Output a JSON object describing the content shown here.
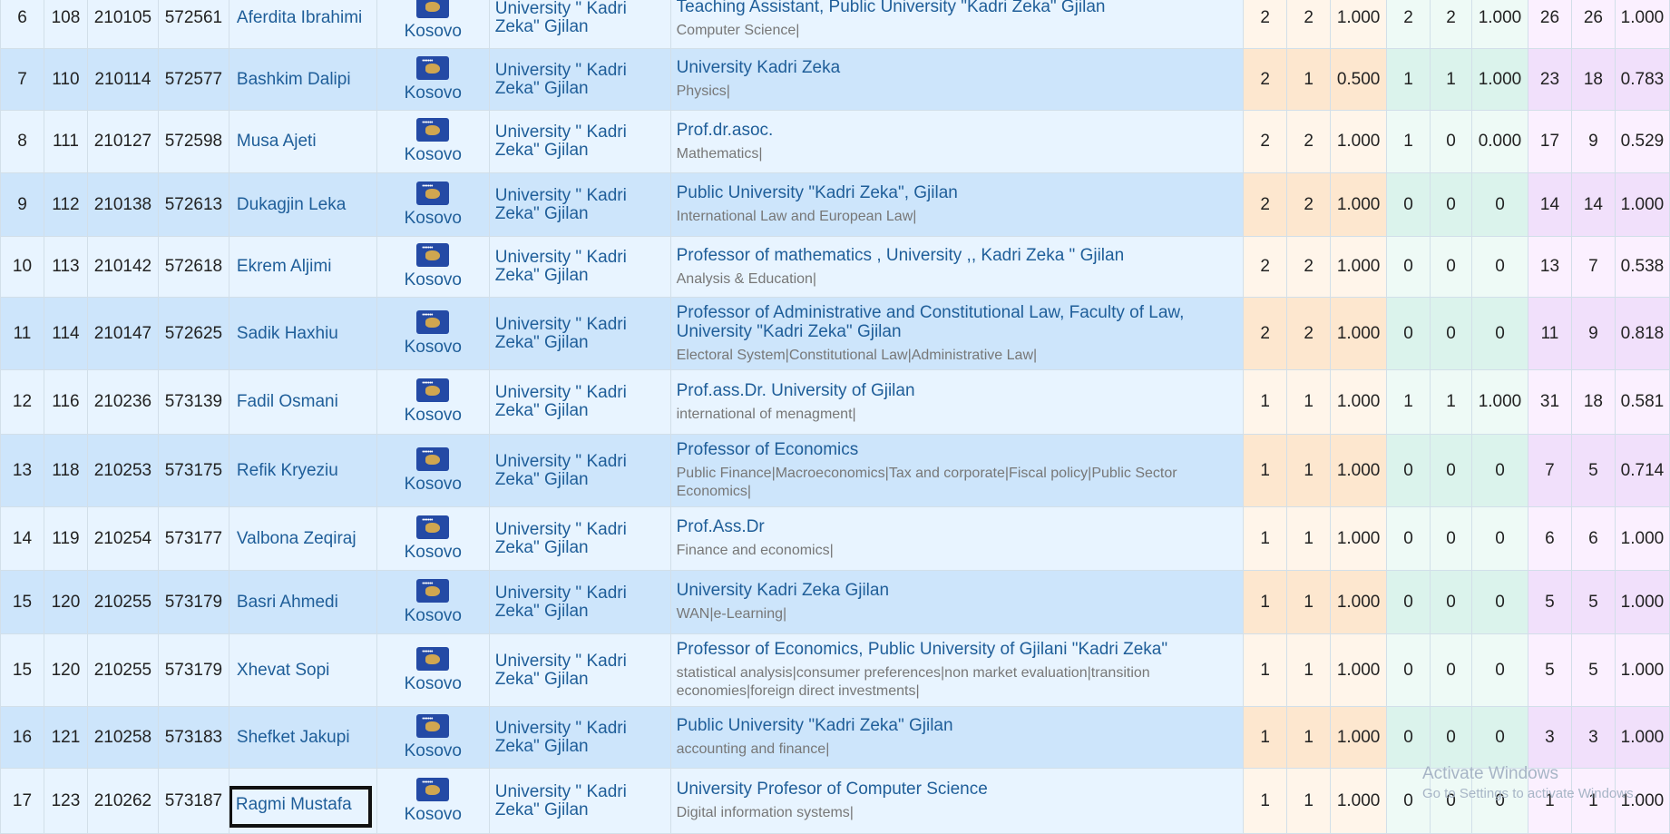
{
  "rows": [
    {
      "rank": "6",
      "id1": "108",
      "id2": "210105",
      "id3": "572561",
      "name": "Aferdita Ibrahimi",
      "country": "Kosovo",
      "institution": "University \" Kadri Zeka\" Gjilan",
      "position_title": "Teaching Assistant, Public University \"Kadri Zeka\" Gjilan",
      "position_area": "Computer Science|",
      "v1": "2",
      "v2": "2",
      "v3": "1.000",
      "v4": "2",
      "v5": "2",
      "v6": "1.000",
      "v7": "26",
      "v8": "26",
      "v9": "1.000"
    },
    {
      "rank": "7",
      "id1": "110",
      "id2": "210114",
      "id3": "572577",
      "name": "Bashkim Dalipi",
      "country": "Kosovo",
      "institution": "University \" Kadri Zeka\" Gjilan",
      "position_title": "University Kadri Zeka",
      "position_area": "Physics|",
      "v1": "2",
      "v2": "1",
      "v3": "0.500",
      "v4": "1",
      "v5": "1",
      "v6": "1.000",
      "v7": "23",
      "v8": "18",
      "v9": "0.783"
    },
    {
      "rank": "8",
      "id1": "111",
      "id2": "210127",
      "id3": "572598",
      "name": "Musa Ajeti",
      "country": "Kosovo",
      "institution": "University \" Kadri Zeka\" Gjilan",
      "position_title": "Prof.dr.asoc.",
      "position_area": "Mathematics|",
      "v1": "2",
      "v2": "2",
      "v3": "1.000",
      "v4": "1",
      "v5": "0",
      "v6": "0.000",
      "v7": "17",
      "v8": "9",
      "v9": "0.529"
    },
    {
      "rank": "9",
      "id1": "112",
      "id2": "210138",
      "id3": "572613",
      "name": "Dukagjin Leka",
      "country": "Kosovo",
      "institution": "University \" Kadri Zeka\" Gjilan",
      "position_title": "Public University \"Kadri Zeka\", Gjilan",
      "position_area": "International Law and European Law|",
      "v1": "2",
      "v2": "2",
      "v3": "1.000",
      "v4": "0",
      "v5": "0",
      "v6": "0",
      "v7": "14",
      "v8": "14",
      "v9": "1.000"
    },
    {
      "rank": "10",
      "id1": "113",
      "id2": "210142",
      "id3": "572618",
      "name": "Ekrem Aljimi",
      "country": "Kosovo",
      "institution": "University \" Kadri Zeka\" Gjilan",
      "position_title": "Professor of mathematics , University ,, Kadri Zeka \" Gjilan",
      "position_area": "Analysis & Education|",
      "v1": "2",
      "v2": "2",
      "v3": "1.000",
      "v4": "0",
      "v5": "0",
      "v6": "0",
      "v7": "13",
      "v8": "7",
      "v9": "0.538"
    },
    {
      "rank": "11",
      "id1": "114",
      "id2": "210147",
      "id3": "572625",
      "name": "Sadik Haxhiu",
      "country": "Kosovo",
      "institution": "University \" Kadri Zeka\" Gjilan",
      "position_title": "Professor of Administrative and Constitutional Law, Faculty of Law, University \"Kadri Zeka\" Gjilan",
      "position_area": "Electoral System|Constitutional Law|Administrative Law|",
      "v1": "2",
      "v2": "2",
      "v3": "1.000",
      "v4": "0",
      "v5": "0",
      "v6": "0",
      "v7": "11",
      "v8": "9",
      "v9": "0.818"
    },
    {
      "rank": "12",
      "id1": "116",
      "id2": "210236",
      "id3": "573139",
      "name": "Fadil Osmani",
      "country": "Kosovo",
      "institution": "University \" Kadri Zeka\" Gjilan",
      "position_title": "Prof.ass.Dr. University of Gjilan",
      "position_area": "international of menagment|",
      "v1": "1",
      "v2": "1",
      "v3": "1.000",
      "v4": "1",
      "v5": "1",
      "v6": "1.000",
      "v7": "31",
      "v8": "18",
      "v9": "0.581"
    },
    {
      "rank": "13",
      "id1": "118",
      "id2": "210253",
      "id3": "573175",
      "name": "Refik Kryeziu",
      "country": "Kosovo",
      "institution": "University \" Kadri Zeka\" Gjilan",
      "position_title": "Professor of Economics",
      "position_area": "Public Finance|Macroeconomics|Tax and corporate|Fiscal policy|Public Sector Economics|",
      "v1": "1",
      "v2": "1",
      "v3": "1.000",
      "v4": "0",
      "v5": "0",
      "v6": "0",
      "v7": "7",
      "v8": "5",
      "v9": "0.714"
    },
    {
      "rank": "14",
      "id1": "119",
      "id2": "210254",
      "id3": "573177",
      "name": "Valbona Zeqiraj",
      "country": "Kosovo",
      "institution": "University \" Kadri Zeka\" Gjilan",
      "position_title": "Prof.Ass.Dr",
      "position_area": "Finance and economics|",
      "v1": "1",
      "v2": "1",
      "v3": "1.000",
      "v4": "0",
      "v5": "0",
      "v6": "0",
      "v7": "6",
      "v8": "6",
      "v9": "1.000"
    },
    {
      "rank": "15",
      "id1": "120",
      "id2": "210255",
      "id3": "573179",
      "name": "Basri Ahmedi",
      "country": "Kosovo",
      "institution": "University \" Kadri Zeka\" Gjilan",
      "position_title": "University Kadri Zeka Gjilan",
      "position_area": "WAN|e-Learning|",
      "v1": "1",
      "v2": "1",
      "v3": "1.000",
      "v4": "0",
      "v5": "0",
      "v6": "0",
      "v7": "5",
      "v8": "5",
      "v9": "1.000"
    },
    {
      "rank": "15",
      "id1": "120",
      "id2": "210255",
      "id3": "573179",
      "name": "Xhevat Sopi",
      "country": "Kosovo",
      "institution": "University \" Kadri Zeka\" Gjilan",
      "position_title": "Professor of Economics, Public University of Gjilani \"Kadri Zeka\"",
      "position_area": "statistical analysis|consumer preferences|non market evaluation|transition economies|foreign direct investments|",
      "v1": "1",
      "v2": "1",
      "v3": "1.000",
      "v4": "0",
      "v5": "0",
      "v6": "0",
      "v7": "5",
      "v8": "5",
      "v9": "1.000"
    },
    {
      "rank": "16",
      "id1": "121",
      "id2": "210258",
      "id3": "573183",
      "name": "Shefket Jakupi",
      "country": "Kosovo",
      "institution": "University \" Kadri Zeka\" Gjilan",
      "position_title": "Public University \"Kadri Zeka\" Gjilan",
      "position_area": "accounting and finance|",
      "v1": "1",
      "v2": "1",
      "v3": "1.000",
      "v4": "0",
      "v5": "0",
      "v6": "0",
      "v7": "3",
      "v8": "3",
      "v9": "1.000"
    },
    {
      "rank": "17",
      "id1": "123",
      "id2": "210262",
      "id3": "573187",
      "name": "Ragmi Mustafa",
      "country": "Kosovo",
      "institution": "University \" Kadri Zeka\" Gjilan",
      "position_title": "University Profesor of Computer Science",
      "position_area": "Digital information systems|",
      "v1": "1",
      "v2": "1",
      "v3": "1.000",
      "v4": "0",
      "v5": "0",
      "v6": "0",
      "v7": "1",
      "v8": "1",
      "v9": "1.000"
    }
  ],
  "marked_row": 12,
  "watermark": {
    "title": "Activate Windows",
    "subtitle": "Go to Settings to activate Windows."
  },
  "colors": {
    "row_odd": "#e8f4ff",
    "row_even": "#cde5fb",
    "link": "#1f5e99",
    "flag": "#244aa5"
  }
}
